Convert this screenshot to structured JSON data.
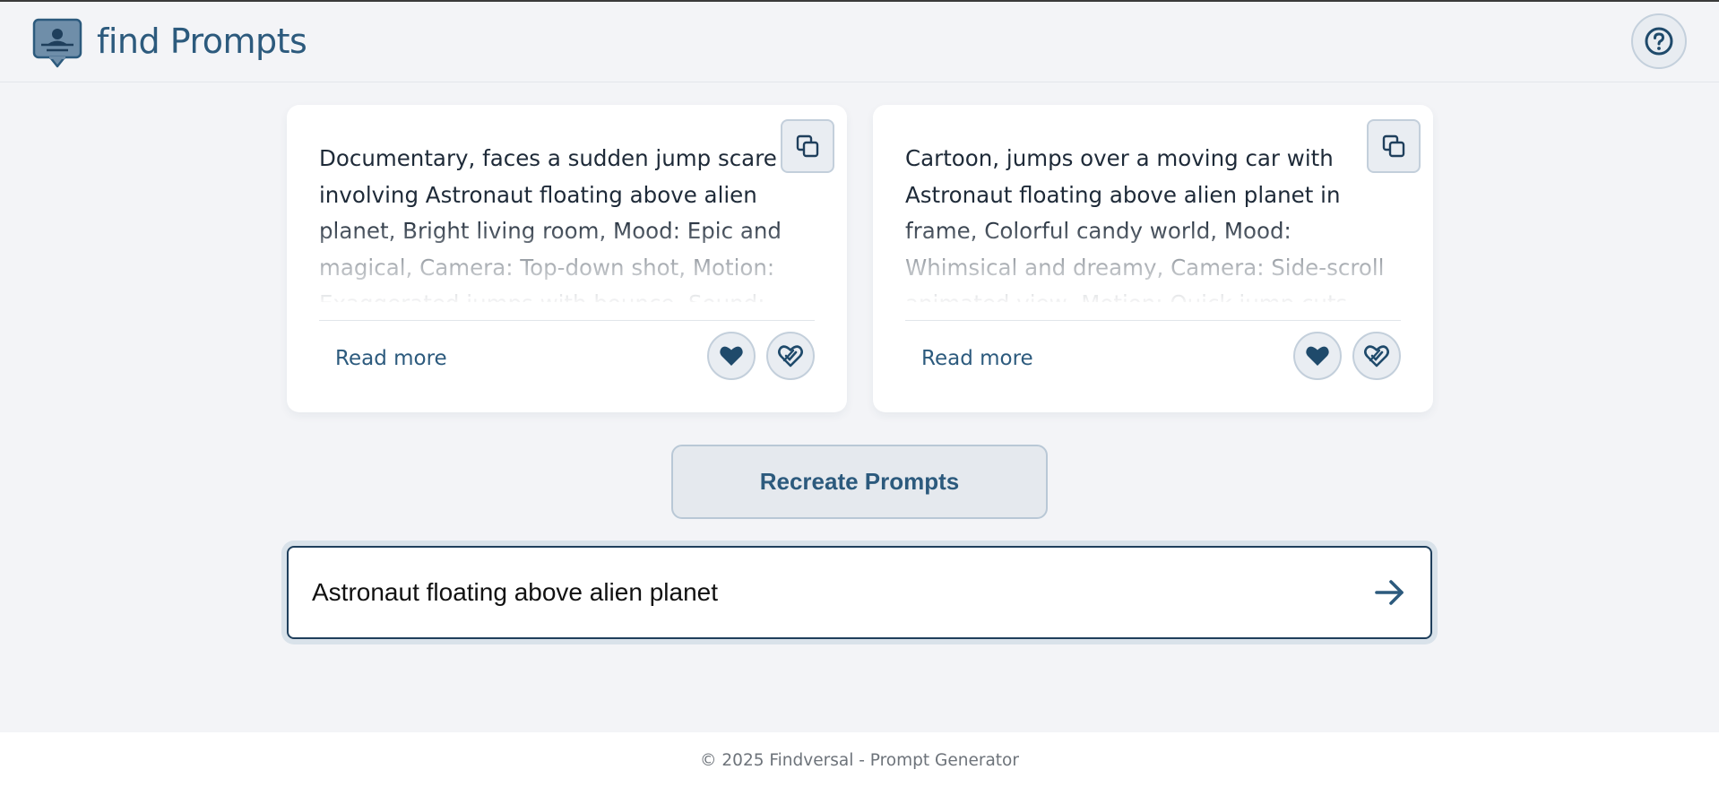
{
  "header": {
    "brand": "find Prompts",
    "logo_icon": "chat-person-icon",
    "help_icon": "question-circle-icon"
  },
  "cards": [
    {
      "text": "Documentary, faces a sudden jump scare involving Astronaut floating above alien planet, Bright living room, Mood: Epic and magical, Camera: Top-down shot, Motion: Exaggerated jumps with bounce, Sound: Dramatic orchestral",
      "read_more": "Read more",
      "copy_icon": "copy-icon",
      "like_icon": "heart-icon",
      "dislike_icon": "heart-crack-icon"
    },
    {
      "text": "Cartoon, jumps over a moving car with Astronaut floating above alien planet in frame, Colorful candy world, Mood: Whimsical and dreamy, Camera: Side-scroll animated view, Motion: Quick jump cuts, Sound: Epic orchestral hit with drums",
      "read_more": "Read more",
      "copy_icon": "copy-icon",
      "like_icon": "heart-icon",
      "dislike_icon": "heart-crack-icon"
    }
  ],
  "recreate": {
    "label": "Recreate Prompts"
  },
  "search": {
    "value": "Astronaut floating above alien planet",
    "submit_icon": "arrow-right-icon"
  },
  "footer": {
    "text": "© 2025 Findversal - Prompt Generator"
  },
  "colors": {
    "accent": "#2c5a7d",
    "background": "#f3f4f7",
    "card": "#ffffff"
  }
}
